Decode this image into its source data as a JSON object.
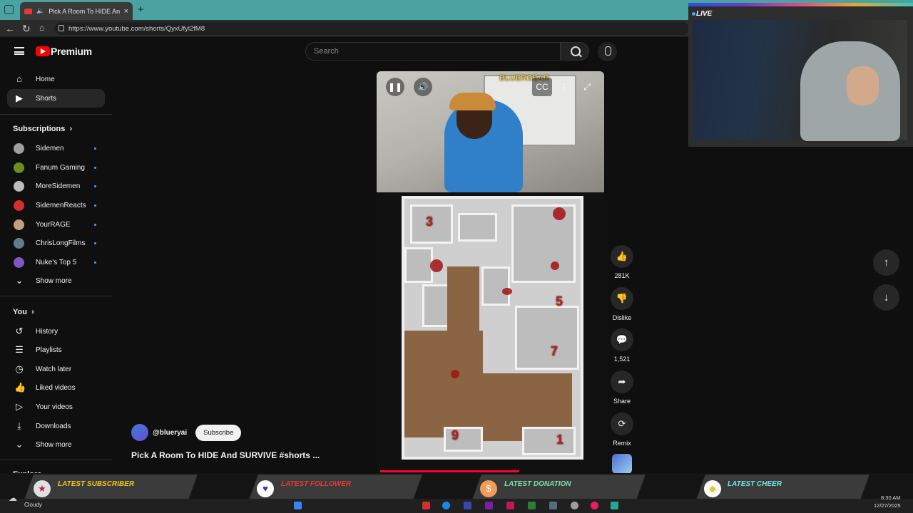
{
  "browser": {
    "tab_title": "Pick A Room To HIDE And SURVIVE",
    "url": "https://www.youtube.com/shorts/QyxUfyl2fM8"
  },
  "header": {
    "logo_text": "Premium",
    "search_placeholder": "Search"
  },
  "sidebar": {
    "main": [
      {
        "label": "Home",
        "icon": "home-icon"
      },
      {
        "label": "Shorts",
        "icon": "shorts-icon"
      }
    ],
    "subscriptions_title": "Subscriptions",
    "subscriptions": [
      {
        "label": "Sidemen",
        "color": "#9e9e9e"
      },
      {
        "label": "Fanum Gaming",
        "color": "#6b8e23"
      },
      {
        "label": "MoreSidemen",
        "color": "#bdbdbd"
      },
      {
        "label": "SidemenReacts",
        "color": "#d32f2f"
      },
      {
        "label": "YourRAGE",
        "color": "#c0a080"
      },
      {
        "label": "ChrisLongFilms",
        "color": "#607d8b"
      },
      {
        "label": "Nuke's Top 5",
        "color": "#7e57c2"
      }
    ],
    "show_more_1": "Show more",
    "you_title": "You",
    "you_items": [
      {
        "label": "History",
        "icon": "history-icon"
      },
      {
        "label": "Playlists",
        "icon": "playlists-icon"
      },
      {
        "label": "Watch later",
        "icon": "watch-later-icon"
      },
      {
        "label": "Liked videos",
        "icon": "liked-videos-icon"
      },
      {
        "label": "Your videos",
        "icon": "your-videos-icon"
      },
      {
        "label": "Downloads",
        "icon": "downloads-icon"
      }
    ],
    "show_more_2": "Show more",
    "explore_title": "Explore"
  },
  "video": {
    "channel": "@blueryai",
    "subscribe_label": "Subscribe",
    "title": "Pick A Room To HIDE And SURVIVE #shorts ...",
    "room_numbers": [
      "3",
      "5",
      "7",
      "9",
      "1"
    ],
    "watermark": "BLUERGEAR",
    "progress_fraction": 0.63
  },
  "actions": {
    "likes": "281K",
    "dislike_label": "Dislike",
    "comments": "1,521",
    "share_label": "Share",
    "remix_label": "Remix"
  },
  "stream": {
    "live_label": "LIVE",
    "alerts": [
      {
        "label": "LATEST SUBSCRIBER",
        "color": "#f0c419"
      },
      {
        "label": "LATEST FOLLOWER",
        "color": "#e53935"
      },
      {
        "label": "LATEST DONATION",
        "color": "#7ee0a6"
      },
      {
        "label": "LATEST CHEER",
        "color": "#6fe3e0"
      }
    ]
  },
  "taskbar": {
    "weather": "Cloudy",
    "time": "8:30 AM",
    "date": "12/27/2025"
  }
}
